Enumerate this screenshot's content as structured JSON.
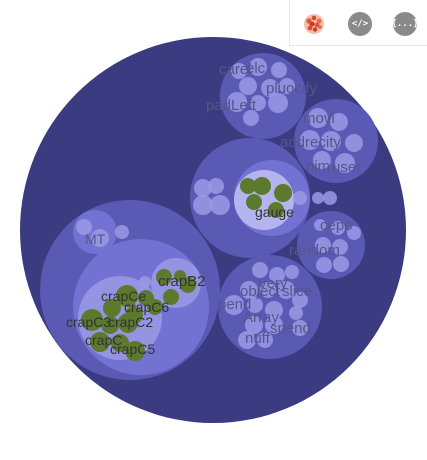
{
  "toolbar": {
    "buttons": [
      {
        "name": "open-in-observable-button",
        "icon": "observable-logo-icon",
        "label": ""
      },
      {
        "name": "view-source-button",
        "icon": "code-icon",
        "label": "</>"
      },
      {
        "name": "view-data-button",
        "icon": "json-braces-icon",
        "label": "{...}"
      }
    ]
  },
  "colors": {
    "root": "#3b3b82",
    "depth1": "#5a5ab4",
    "depth2": "#7272d2",
    "depth3": "#9a9ae6",
    "selected_inner": "#b4b4f0",
    "highlight_leaf": "#5b7a2e",
    "label": "#55558a"
  },
  "chart_data": {
    "type": "circle-packing",
    "labels": [
      "carel",
      "elc",
      "pluocify",
      "padLeft",
      "movi",
      "addrecity",
      "nim",
      "user",
      "gauge",
      "MT",
      "crapB2",
      "crapC6",
      "crapCe",
      "crapC2",
      "crapC3",
      "crapC",
      "crapC5",
      "cepo",
      "random",
      "very",
      "object",
      "slice",
      "pend",
      "Array",
      "spend",
      "nuff"
    ]
  }
}
